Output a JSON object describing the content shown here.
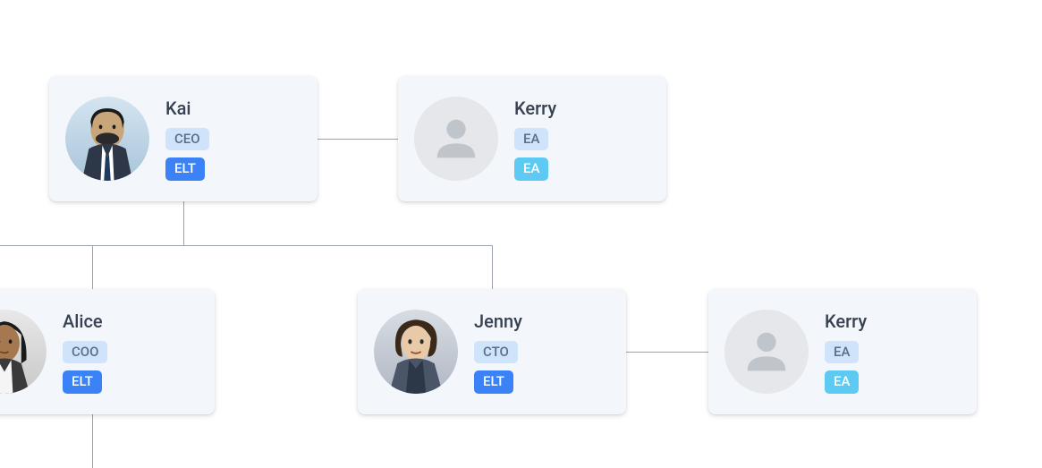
{
  "people": {
    "kai": {
      "name": "Kai",
      "role": "CEO",
      "team": "ELT",
      "team_type": "elt",
      "has_photo": true
    },
    "kerry_top": {
      "name": "Kerry",
      "role": "EA",
      "team": "EA",
      "team_type": "ea",
      "has_photo": false
    },
    "alice": {
      "name": "Alice",
      "role": "COO",
      "team": "ELT",
      "team_type": "elt",
      "has_photo": true
    },
    "jenny": {
      "name": "Jenny",
      "role": "CTO",
      "team": "ELT",
      "team_type": "elt",
      "has_photo": true
    },
    "kerry_bottom": {
      "name": "Kerry",
      "role": "EA",
      "team": "EA",
      "team_type": "ea",
      "has_photo": false
    }
  },
  "connections": [
    {
      "from": "kai",
      "to": "kerry_top",
      "type": "peer"
    },
    {
      "from": "kai",
      "to": "alice",
      "type": "child"
    },
    {
      "from": "kai",
      "to": "jenny",
      "type": "child"
    },
    {
      "from": "jenny",
      "to": "kerry_bottom",
      "type": "peer"
    }
  ]
}
